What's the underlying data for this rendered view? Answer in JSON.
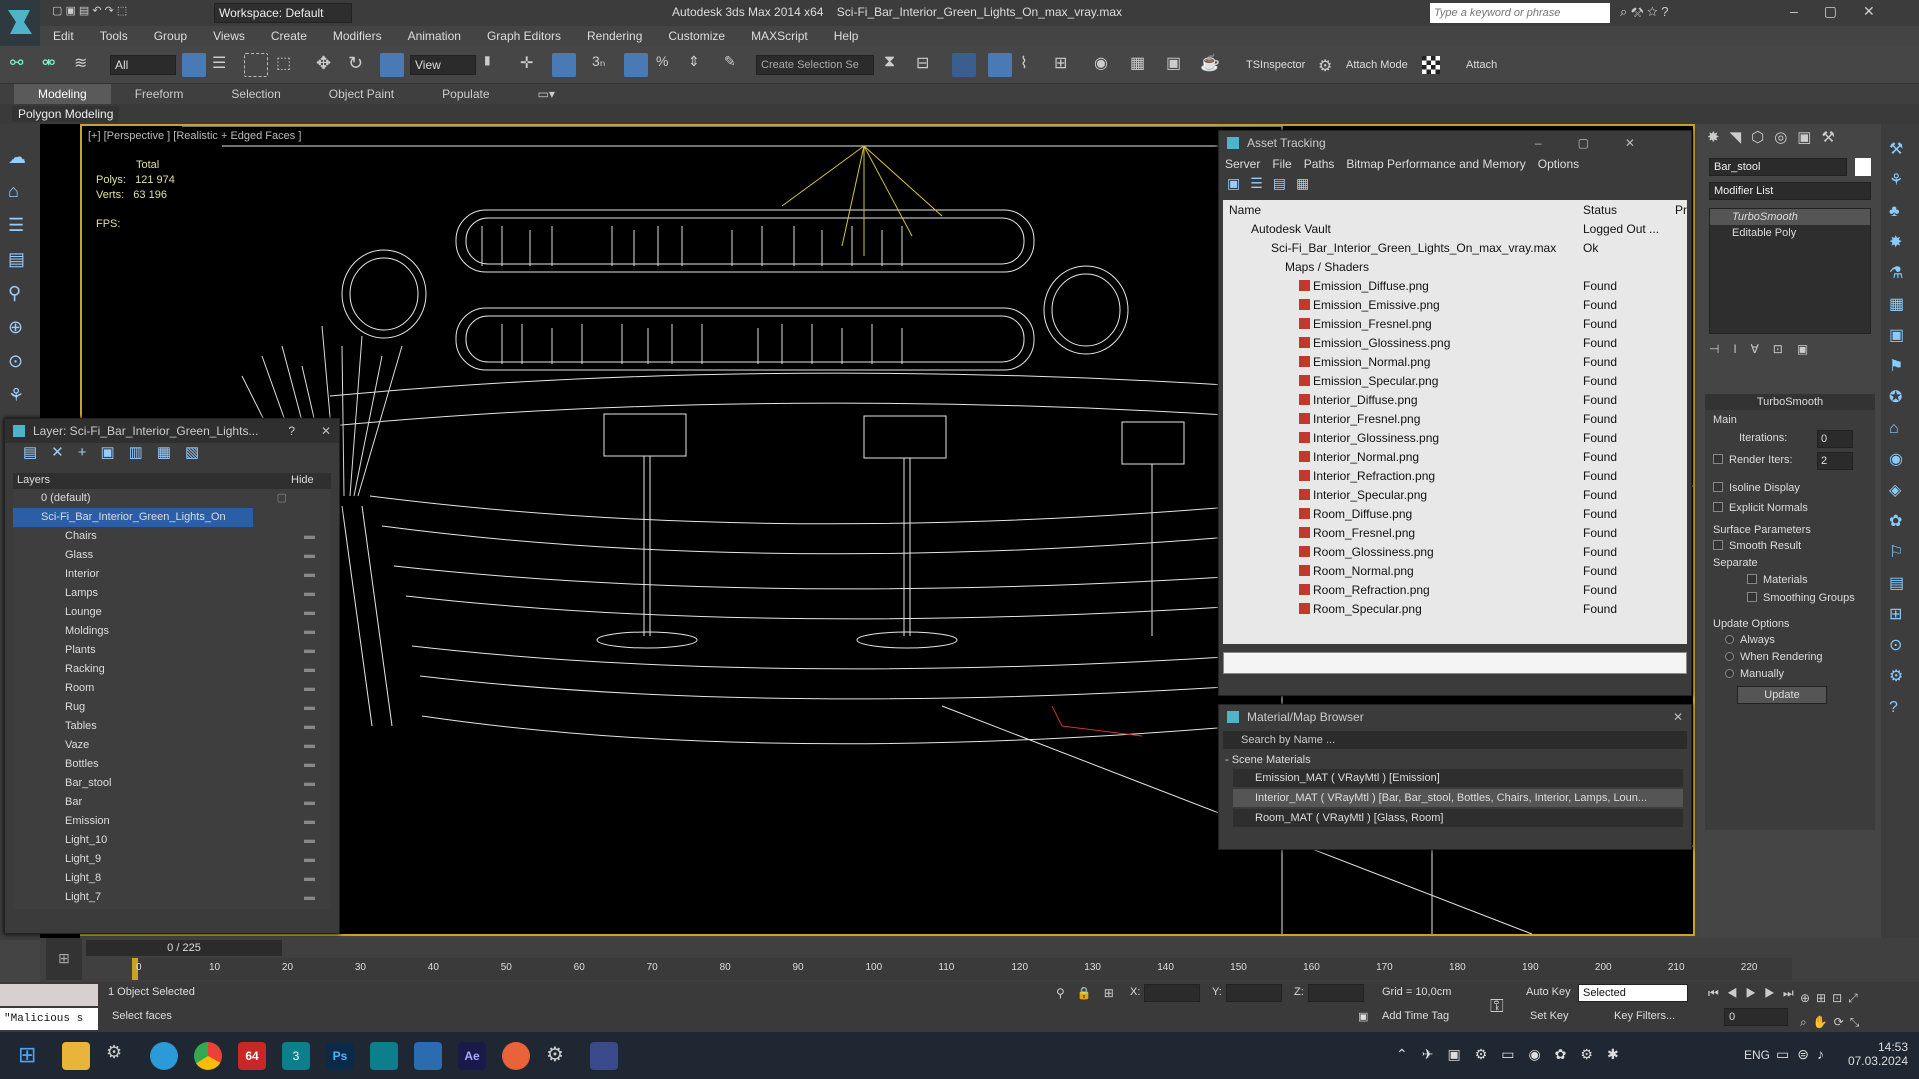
{
  "title": {
    "workspace": "Workspace: Default",
    "app": "Autodesk 3ds Max  2014 x64",
    "file": "Sci-Fi_Bar_Interior_Green_Lights_On_max_vray.max",
    "search_placeholder": "Type a keyword or phrase"
  },
  "menu": [
    "Edit",
    "Tools",
    "Group",
    "Views",
    "Create",
    "Modifiers",
    "Animation",
    "Graph Editors",
    "Rendering",
    "Customize",
    "MAXScript",
    "Help"
  ],
  "toolbar": {
    "filter": "All",
    "refcoord": "View",
    "selset": "Create Selection Se",
    "tsinspector": "TSInspector",
    "attach_mode": "Attach Mode",
    "attach": "Attach"
  },
  "ribbon": {
    "tabs": [
      "Modeling",
      "Freeform",
      "Selection",
      "Object Paint",
      "Populate"
    ],
    "sub": "Polygon Modeling"
  },
  "viewport": {
    "label": "[+] [Perspective ] [Realistic + Edged Faces ]",
    "total": "Total",
    "polys_label": "Polys:",
    "polys": "121 974",
    "verts_label": "Verts:",
    "verts": "63 196",
    "fps": "FPS:"
  },
  "layer": {
    "title": "Layer: Sci-Fi_Bar_Interior_Green_Lights...",
    "help": "?",
    "col_layers": "Layers",
    "col_hide": "Hide",
    "default": "0 (default)",
    "selected": "Sci-Fi_Bar_Interior_Green_Lights_On",
    "items": [
      "Chairs",
      "Glass",
      "Interior",
      "Lamps",
      "Lounge",
      "Moldings",
      "Plants",
      "Racking",
      "Room",
      "Rug",
      "Tables",
      "Vaze",
      "Bottles",
      "Bar_stool",
      "Bar",
      "Emission",
      "Light_10",
      "Light_9",
      "Light_8",
      "Light_7"
    ]
  },
  "asset": {
    "title": "Asset Tracking",
    "menu": [
      "Server",
      "File",
      "Paths",
      "Bitmap Performance and Memory",
      "Options"
    ],
    "col_name": "Name",
    "col_status": "Status",
    "col_p": "Pr",
    "vault": "Autodesk Vault",
    "vault_status": "Logged Out ...",
    "file": "Sci-Fi_Bar_Interior_Green_Lights_On_max_vray.max",
    "file_status": "Ok",
    "maps": "Maps / Shaders",
    "files": [
      "Emission_Diffuse.png",
      "Emission_Emissive.png",
      "Emission_Fresnel.png",
      "Emission_Glossiness.png",
      "Emission_Normal.png",
      "Emission_Specular.png",
      "Interior_Diffuse.png",
      "Interior_Fresnel.png",
      "Interior_Glossiness.png",
      "Interior_Normal.png",
      "Interior_Refraction.png",
      "Interior_Specular.png",
      "Room_Diffuse.png",
      "Room_Fresnel.png",
      "Room_Glossiness.png",
      "Room_Normal.png",
      "Room_Refraction.png",
      "Room_Specular.png"
    ],
    "found": "Found"
  },
  "matbrowser": {
    "title": "Material/Map Browser",
    "search": "Search by Name ...",
    "group": "- Scene Materials",
    "items": [
      "Emission_MAT  ( VRayMtl )  [Emission]",
      "Interior_MAT  ( VRayMtl )  [Bar, Bar_stool, Bottles, Chairs, Interior, Lamps, Loun...",
      "Room_MAT  ( VRayMtl )  [Glass, Room]"
    ]
  },
  "cmd": {
    "object_name": "Bar_stool",
    "modifier_list": "Modifier List",
    "stack": [
      "TurboSmooth",
      "Editable Poly"
    ],
    "rollout": "TurboSmooth",
    "main": "Main",
    "iterations_label": "Iterations:",
    "iterations": "0",
    "render_iters_label": "Render Iters:",
    "render_iters": "2",
    "isoline": "Isoline Display",
    "explicit": "Explicit Normals",
    "surface": "Surface Parameters",
    "smooth_result": "Smooth Result",
    "separate": "Separate",
    "materials": "Materials",
    "smoothing_groups": "Smoothing Groups",
    "update_options": "Update Options",
    "always": "Always",
    "when_rendering": "When Rendering",
    "manually": "Manually",
    "update": "Update"
  },
  "timeline": {
    "frame": "0 / 225",
    "ticks": [
      "0",
      "10",
      "20",
      "30",
      "40",
      "50",
      "60",
      "70",
      "80",
      "90",
      "100",
      "110",
      "120",
      "130",
      "140",
      "150",
      "160",
      "170",
      "180",
      "190",
      "200",
      "210",
      "220"
    ]
  },
  "status": {
    "selected": "1 Object Selected",
    "prompt": "Select faces",
    "script": "\"Malicious s",
    "x": "X:",
    "y": "Y:",
    "z": "Z:",
    "grid": "Grid = 10,0cm",
    "add_time_tag": "Add Time Tag",
    "auto_key": "Auto Key",
    "selected_mode": "Selected",
    "set_key": "Set Key",
    "key_filters": "Key Filters...",
    "frame_field": "0"
  },
  "taskbar": {
    "lang": "ENG",
    "time": "14:53",
    "date": "07.03.2024",
    "badge": "64"
  },
  "colors": {
    "viewport_border": "#c9a227",
    "selected_layer": "#2a5fa8",
    "found_icon": "#c0392b"
  }
}
